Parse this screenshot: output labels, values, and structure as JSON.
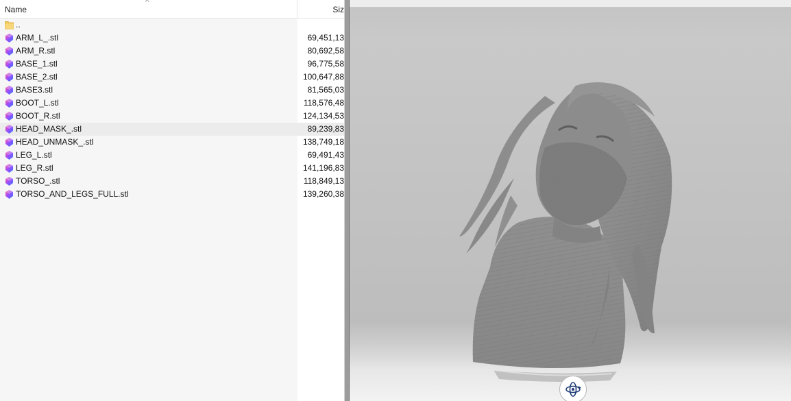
{
  "file_list": {
    "columns": {
      "name": "Name",
      "size": "Siz"
    },
    "parent_folder": "..",
    "files": [
      {
        "name": "ARM_L_.stl",
        "size": "69,451,13"
      },
      {
        "name": "ARM_R.stl",
        "size": "80,692,58"
      },
      {
        "name": "BASE_1.stl",
        "size": "96,775,58"
      },
      {
        "name": "BASE_2.stl",
        "size": "100,647,88"
      },
      {
        "name": "BASE3.stl",
        "size": "81,565,03"
      },
      {
        "name": "BOOT_L.stl",
        "size": "118,576,48"
      },
      {
        "name": "BOOT_R.stl",
        "size": "124,134,53"
      },
      {
        "name": "HEAD_MASK_.stl",
        "size": "89,239,83",
        "selected": true
      },
      {
        "name": "HEAD_UNMASK_.stl",
        "size": "138,749,18"
      },
      {
        "name": "LEG_L.stl",
        "size": "69,491,43"
      },
      {
        "name": "LEG_R.stl",
        "size": "141,196,83"
      },
      {
        "name": "TORSO_.stl",
        "size": "118,849,13"
      },
      {
        "name": "TORSO_AND_LEGS_FULL.stl",
        "size": "139,260,38"
      }
    ],
    "file_icon": "3d-viewer-file-icon",
    "folder_icon": "folder-icon",
    "sort_icon": "sort-ascending-caret-icon"
  },
  "viewer": {
    "model_description_icon": "3d-model",
    "rotate_control_icon": "rotate-orbit-icon"
  },
  "colors": {
    "selected_row": "#ececec",
    "folder": "#f4c85a",
    "model": "#8a8a8a"
  }
}
